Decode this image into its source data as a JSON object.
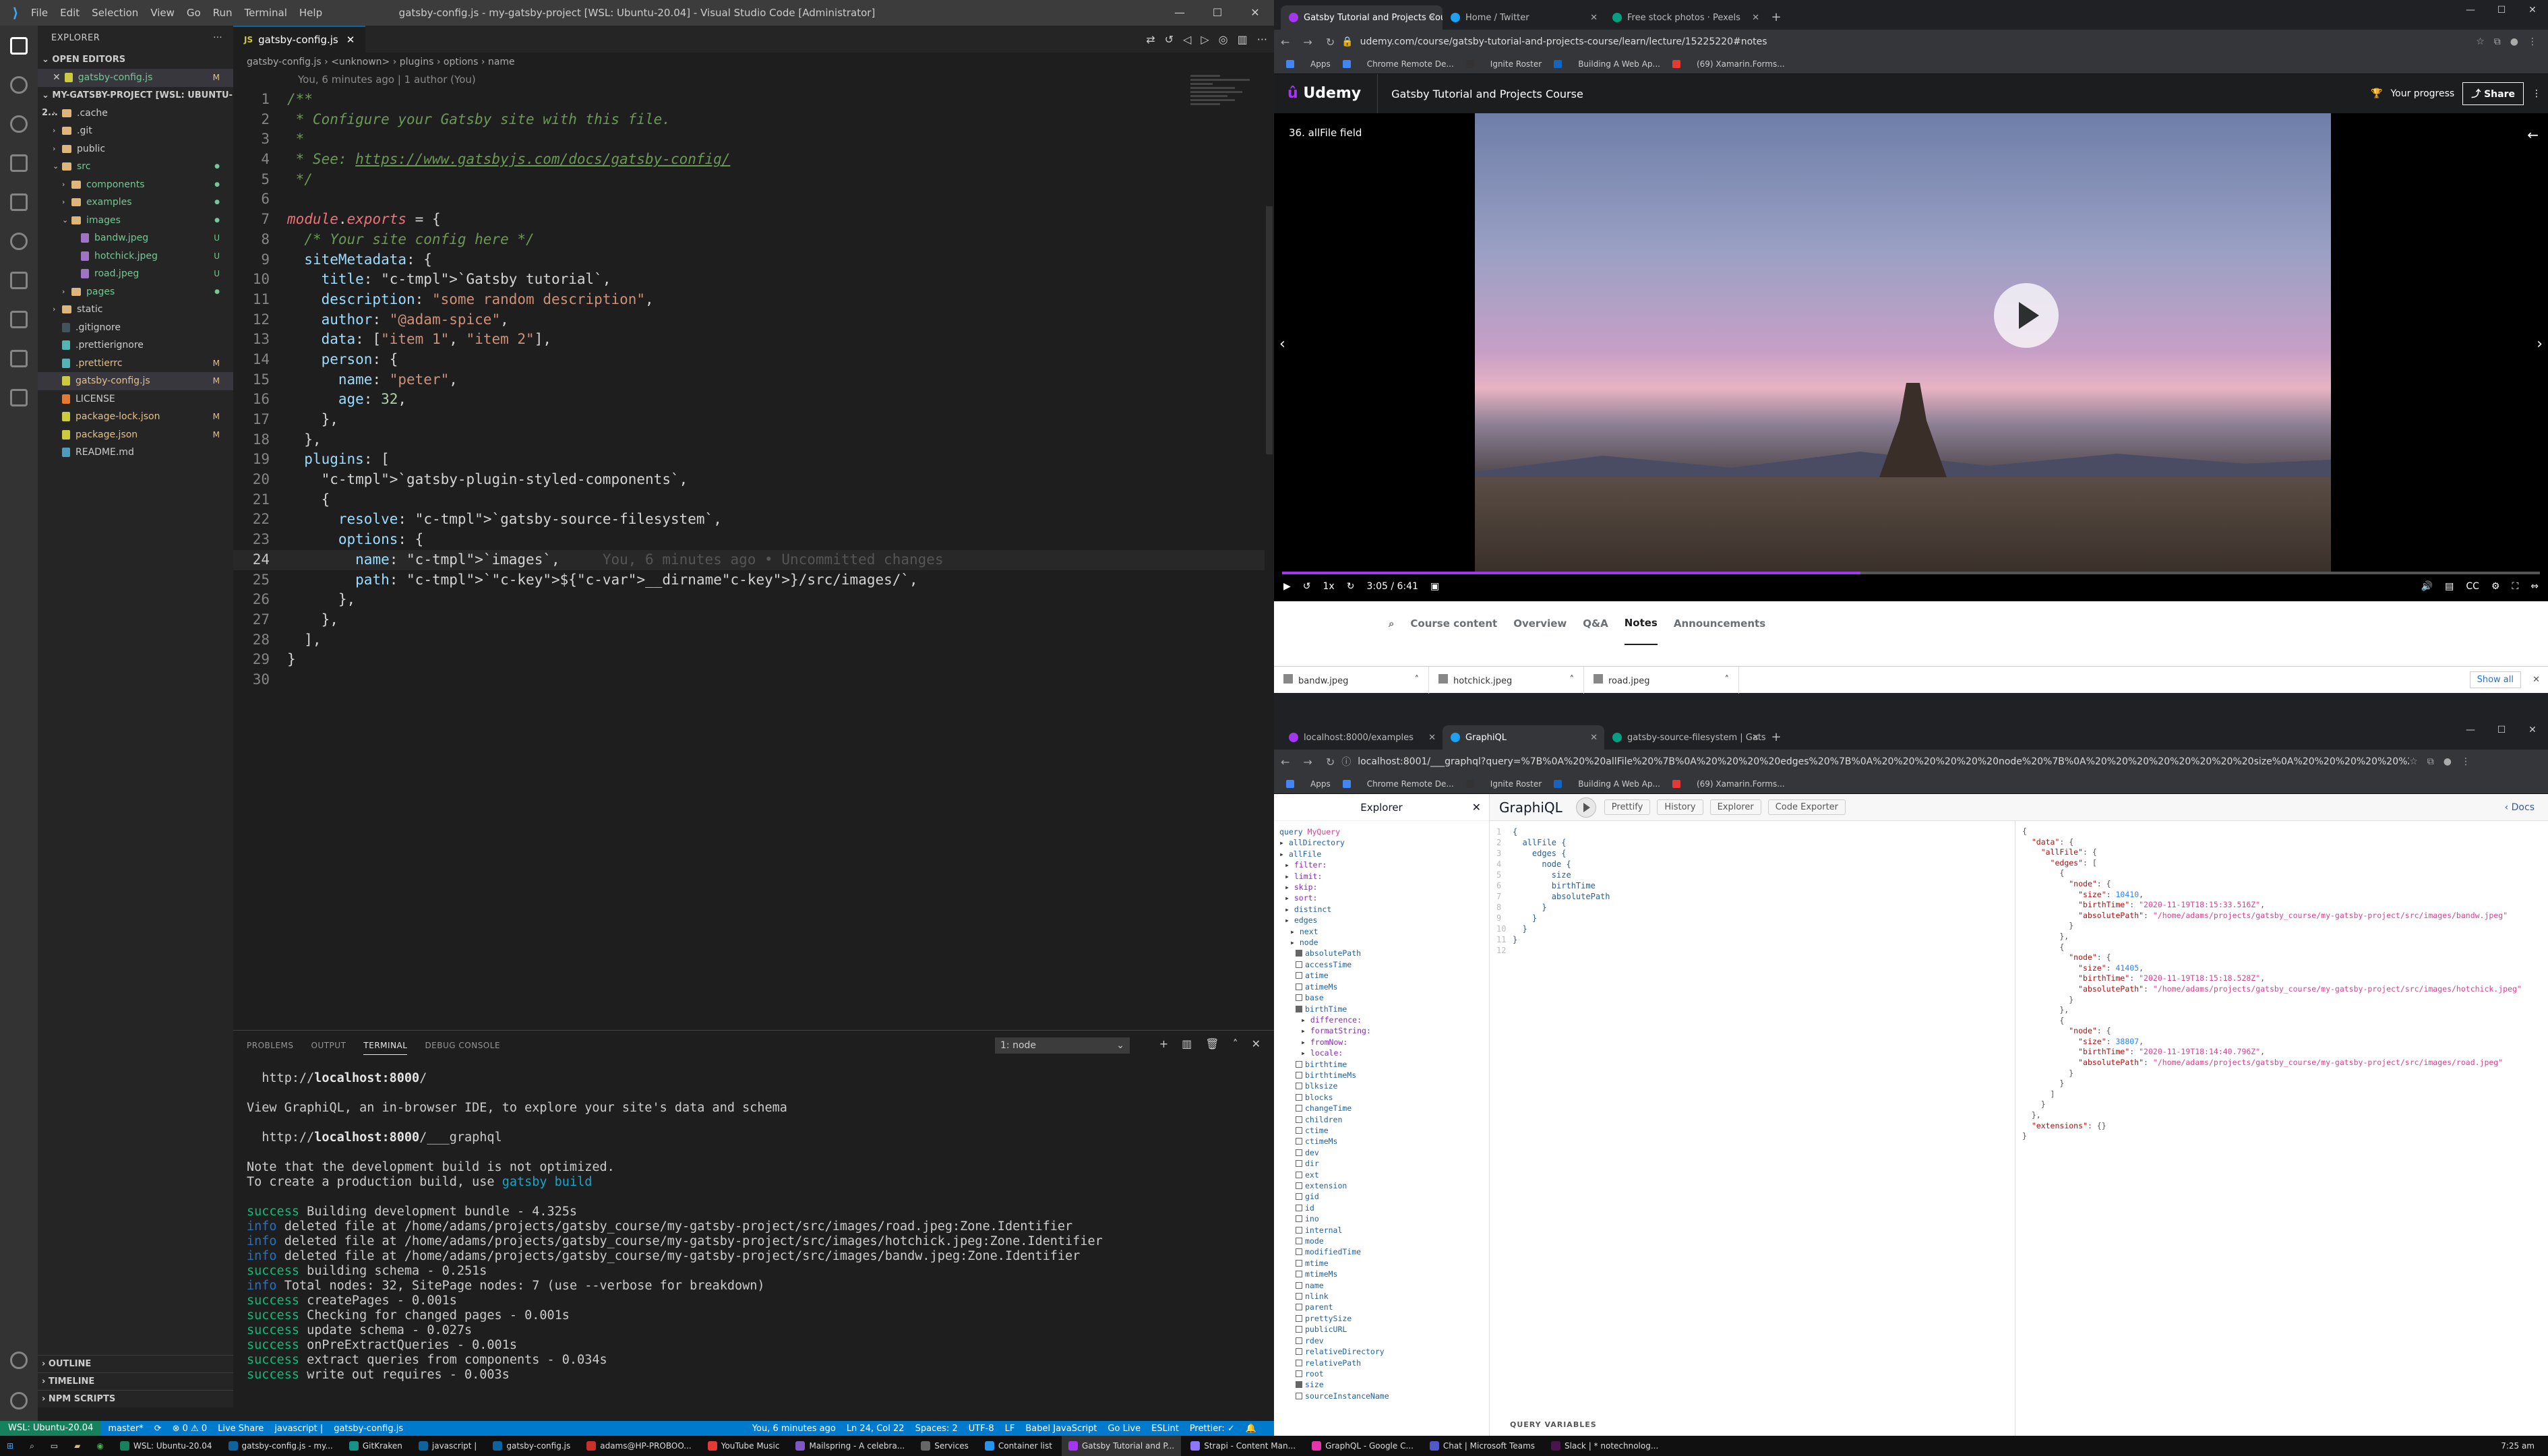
{
  "vscode": {
    "title": "gatsby-config.js - my-gatsby-project [WSL: Ubuntu-20.04] - Visual Studio Code [Administrator]",
    "menu": [
      "File",
      "Edit",
      "Selection",
      "View",
      "Go",
      "Run",
      "Terminal",
      "Help"
    ],
    "explorer_label": "EXPLORER",
    "open_editors_label": "OPEN EDITORS",
    "open_editor_file": "gatsby-config.js",
    "open_editor_badge": "M",
    "project_label": "MY-GATSBY-PROJECT [WSL: UBUNTU-2...",
    "tree": [
      {
        "name": ".cache",
        "git": ""
      },
      {
        "name": ".git",
        "git": ""
      },
      {
        "name": "public",
        "git": ""
      },
      {
        "name": "src",
        "git": ""
      },
      {
        "name": "components",
        "git": ""
      },
      {
        "name": "examples",
        "git": ""
      },
      {
        "name": "images",
        "git": ""
      },
      {
        "name": "bandw.jpeg",
        "git": "U"
      },
      {
        "name": "hotchick.jpeg",
        "git": "U"
      },
      {
        "name": "road.jpeg",
        "git": "U"
      },
      {
        "name": "pages",
        "git": ""
      },
      {
        "name": "static",
        "git": ""
      },
      {
        "name": ".gitignore",
        "git": ""
      },
      {
        "name": ".prettierignore",
        "git": ""
      },
      {
        "name": ".prettierrc",
        "git": "M"
      },
      {
        "name": "gatsby-config.js",
        "git": "M"
      },
      {
        "name": "LICENSE",
        "git": ""
      },
      {
        "name": "package-lock.json",
        "git": "M"
      },
      {
        "name": "package.json",
        "git": "M"
      },
      {
        "name": "README.md",
        "git": ""
      }
    ],
    "outline_label": "OUTLINE",
    "timeline_label": "TIMELINE",
    "npm_label": "NPM SCRIPTS",
    "tab_label": "gatsby-config.js",
    "breadcrumb": [
      "gatsby-config.js",
      "<unknown>",
      "plugins",
      "options",
      "name"
    ],
    "blame_top": "You, 6 minutes ago | 1 author (You)",
    "ghost_blame": "You, 6 minutes ago • Uncommitted changes",
    "code_lines": [
      "/**",
      " * Configure your Gatsby site with this file.",
      " *",
      " * See: https://www.gatsbyjs.com/docs/gatsby-config/",
      " */",
      "",
      "module.exports = {",
      "  /* Your site config here */",
      "  siteMetadata: {",
      "    title: `Gatsby tutorial`,",
      "    description: \"some random description\",",
      "    author: \"@adam-spice\",",
      "    data: [\"item 1\", \"item 2\"],",
      "    person: {",
      "      name: \"peter\",",
      "      age: 32,",
      "    },",
      "  },",
      "  plugins: [",
      "    `gatsby-plugin-styled-components`,",
      "    {",
      "      resolve: `gatsby-source-filesystem`,",
      "      options: {",
      "        name: `images`,",
      "        path: `${__dirname}/src/images/`,",
      "      },",
      "    },",
      "  ],",
      "}",
      ""
    ],
    "panel_tabs": [
      "PROBLEMS",
      "OUTPUT",
      "TERMINAL",
      "DEBUG CONSOLE"
    ],
    "terminal_select": "1: node",
    "terminal_lines": [
      {
        "t": "  http://localhost:8000/",
        "c": ""
      },
      {
        "t": "",
        "c": ""
      },
      {
        "t": "View GraphiQL, an in-browser IDE, to explore your site's data and schema",
        "c": ""
      },
      {
        "t": "",
        "c": ""
      },
      {
        "t": "  http://localhost:8000/___graphql",
        "c": ""
      },
      {
        "t": "",
        "c": ""
      },
      {
        "t": "Note that the development build is not optimized.",
        "c": ""
      },
      {
        "t": "To create a production build, use gatsby build",
        "c": ""
      },
      {
        "t": "",
        "c": ""
      },
      {
        "t": "success Building development bundle - 4.325s",
        "c": "s"
      },
      {
        "t": "info deleted file at /home/adams/projects/gatsby_course/my-gatsby-project/src/images/road.jpeg:Zone.Identifier",
        "c": "i"
      },
      {
        "t": "info deleted file at /home/adams/projects/gatsby_course/my-gatsby-project/src/images/hotchick.jpeg:Zone.Identifier",
        "c": "i"
      },
      {
        "t": "info deleted file at /home/adams/projects/gatsby_course/my-gatsby-project/src/images/bandw.jpeg:Zone.Identifier",
        "c": "i"
      },
      {
        "t": "success building schema - 0.251s",
        "c": "s"
      },
      {
        "t": "info Total nodes: 32, SitePage nodes: 7 (use --verbose for breakdown)",
        "c": "i"
      },
      {
        "t": "success createPages - 0.001s",
        "c": "s"
      },
      {
        "t": "success Checking for changed pages - 0.001s",
        "c": "s"
      },
      {
        "t": "success update schema - 0.027s",
        "c": "s"
      },
      {
        "t": "success onPreExtractQueries - 0.001s",
        "c": "s"
      },
      {
        "t": "success extract queries from components - 0.034s",
        "c": "s"
      },
      {
        "t": "success write out requires - 0.003s",
        "c": "s"
      }
    ],
    "status": {
      "remote": "WSL: Ubuntu-20.04",
      "branch": "master*",
      "errors": "⊗ 0 ⚠ 0",
      "live_share": "Live Share",
      "js": "javascript |",
      "file": "gatsby-config.js",
      "blame": "You, 6 minutes ago",
      "position": "Ln 24, Col 22",
      "spaces": "Spaces: 2",
      "encoding": "UTF-8",
      "eol": "LF",
      "lang": "Babel JavaScript",
      "golive": "Go Live",
      "eslint": "ESLint",
      "prettier": "Prettier: ✓"
    }
  },
  "browser_top": {
    "tabs": [
      "Gatsby Tutorial and Projects Cou",
      "Home / Twitter",
      "Free stock photos · Pexels"
    ],
    "url": "udemy.com/course/gatsby-tutorial-and-projects-course/learn/lecture/15225220#notes",
    "bookmarks": [
      "Apps",
      "Chrome Remote De...",
      "Ignite Roster",
      "Building A Web Ap...",
      "(69) Xamarin.Forms..."
    ],
    "udemy_logo": "Udemy",
    "course_title": "Gatsby Tutorial and Projects Course",
    "progress_label": "Your progress",
    "share_label": "Share",
    "lecture": "36. allFile field",
    "time": "3:05 / 6:41",
    "speed": "1x",
    "video_progress": 0.46,
    "course_tabs": [
      "Course content",
      "Overview",
      "Q&A",
      "Notes",
      "Announcements"
    ],
    "downloads": [
      "bandw.jpeg",
      "hotchick.jpeg",
      "road.jpeg"
    ],
    "show_all": "Show all"
  },
  "browser_bottom": {
    "tabs": [
      "localhost:8000/examples",
      "GraphiQL",
      "gatsby-source-filesystem | Gats"
    ],
    "url": "localhost:8001/___graphql?query=%7B%0A%20%20allFile%20%7B%0A%20%20%20%20edges%20%7B%0A%20%20%20%20%20%20node%20%7B%0A%20%20%20%20%20%20%20%20size%0A%20%20%20%20%20%20%20%20birthTime%0A%20%20%20%20%20%20%20",
    "bookmarks": [
      "Apps",
      "Chrome Remote De...",
      "Ignite Roster",
      "Building A Web Ap...",
      "(69) Xamarin.Forms..."
    ],
    "explorer_title": "Explorer",
    "query_name": "MyQuery",
    "graphiql_title": "GraphiQL",
    "buttons": [
      "Prettify",
      "History",
      "Explorer",
      "Code Exporter"
    ],
    "docs": "Docs",
    "explorer_fields": [
      {
        "t": "allDirectory",
        "lvl": 0,
        "k": "f",
        "chk": ""
      },
      {
        "t": "allFile",
        "lvl": 0,
        "k": "f",
        "chk": ""
      },
      {
        "t": "filter:",
        "lvl": 1,
        "k": "a",
        "chk": ""
      },
      {
        "t": "limit:",
        "lvl": 1,
        "k": "a",
        "chk": ""
      },
      {
        "t": "skip:",
        "lvl": 1,
        "k": "a",
        "chk": ""
      },
      {
        "t": "sort:",
        "lvl": 1,
        "k": "a",
        "chk": ""
      },
      {
        "t": "distinct",
        "lvl": 1,
        "k": "f",
        "chk": ""
      },
      {
        "t": "edges",
        "lvl": 1,
        "k": "f",
        "chk": ""
      },
      {
        "t": "next",
        "lvl": 2,
        "k": "f",
        "chk": ""
      },
      {
        "t": "node",
        "lvl": 2,
        "k": "f",
        "chk": ""
      },
      {
        "t": "absolutePath",
        "lvl": 3,
        "k": "f",
        "chk": "on"
      },
      {
        "t": "accessTime",
        "lvl": 3,
        "k": "f",
        "chk": "off"
      },
      {
        "t": "atime",
        "lvl": 3,
        "k": "f",
        "chk": "off"
      },
      {
        "t": "atimeMs",
        "lvl": 3,
        "k": "f",
        "chk": "off"
      },
      {
        "t": "base",
        "lvl": 3,
        "k": "f",
        "chk": "off"
      },
      {
        "t": "birthTime",
        "lvl": 3,
        "k": "f",
        "chk": "on"
      },
      {
        "t": "difference:",
        "lvl": 4,
        "k": "a",
        "chk": ""
      },
      {
        "t": "formatString:",
        "lvl": 4,
        "k": "a",
        "chk": ""
      },
      {
        "t": "fromNow:",
        "lvl": 4,
        "k": "a",
        "chk": ""
      },
      {
        "t": "locale:",
        "lvl": 4,
        "k": "a",
        "chk": ""
      },
      {
        "t": "birthtime",
        "lvl": 3,
        "k": "f",
        "chk": "off"
      },
      {
        "t": "birthtimeMs",
        "lvl": 3,
        "k": "f",
        "chk": "off"
      },
      {
        "t": "blksize",
        "lvl": 3,
        "k": "f",
        "chk": "off"
      },
      {
        "t": "blocks",
        "lvl": 3,
        "k": "f",
        "chk": "off"
      },
      {
        "t": "changeTime",
        "lvl": 3,
        "k": "f",
        "chk": "off"
      },
      {
        "t": "children",
        "lvl": 3,
        "k": "f",
        "chk": "off"
      },
      {
        "t": "ctime",
        "lvl": 3,
        "k": "f",
        "chk": "off"
      },
      {
        "t": "ctimeMs",
        "lvl": 3,
        "k": "f",
        "chk": "off"
      },
      {
        "t": "dev",
        "lvl": 3,
        "k": "f",
        "chk": "off"
      },
      {
        "t": "dir",
        "lvl": 3,
        "k": "f",
        "chk": "off"
      },
      {
        "t": "ext",
        "lvl": 3,
        "k": "f",
        "chk": "off"
      },
      {
        "t": "extension",
        "lvl": 3,
        "k": "f",
        "chk": "off"
      },
      {
        "t": "gid",
        "lvl": 3,
        "k": "f",
        "chk": "off"
      },
      {
        "t": "id",
        "lvl": 3,
        "k": "f",
        "chk": "off"
      },
      {
        "t": "ino",
        "lvl": 3,
        "k": "f",
        "chk": "off"
      },
      {
        "t": "internal",
        "lvl": 3,
        "k": "f",
        "chk": "off"
      },
      {
        "t": "mode",
        "lvl": 3,
        "k": "f",
        "chk": "off"
      },
      {
        "t": "modifiedTime",
        "lvl": 3,
        "k": "f",
        "chk": "off"
      },
      {
        "t": "mtime",
        "lvl": 3,
        "k": "f",
        "chk": "off"
      },
      {
        "t": "mtimeMs",
        "lvl": 3,
        "k": "f",
        "chk": "off"
      },
      {
        "t": "name",
        "lvl": 3,
        "k": "f",
        "chk": "off"
      },
      {
        "t": "nlink",
        "lvl": 3,
        "k": "f",
        "chk": "off"
      },
      {
        "t": "parent",
        "lvl": 3,
        "k": "f",
        "chk": "off"
      },
      {
        "t": "prettySize",
        "lvl": 3,
        "k": "f",
        "chk": "off"
      },
      {
        "t": "publicURL",
        "lvl": 3,
        "k": "f",
        "chk": "off"
      },
      {
        "t": "rdev",
        "lvl": 3,
        "k": "f",
        "chk": "off"
      },
      {
        "t": "relativeDirectory",
        "lvl": 3,
        "k": "f",
        "chk": "off"
      },
      {
        "t": "relativePath",
        "lvl": 3,
        "k": "f",
        "chk": "off"
      },
      {
        "t": "root",
        "lvl": 3,
        "k": "f",
        "chk": "off"
      },
      {
        "t": "size",
        "lvl": 3,
        "k": "f",
        "chk": "on"
      },
      {
        "t": "sourceInstanceName",
        "lvl": 3,
        "k": "f",
        "chk": "off"
      }
    ],
    "query_lines": [
      "{",
      "  allFile {",
      "    edges {",
      "      node {",
      "        size",
      "        birthTime",
      "        absolutePath",
      "      }",
      "    }",
      "  }",
      "}",
      ""
    ],
    "query_vars": "QUERY VARIABLES",
    "result": {
      "nodes": [
        {
          "size": "10410",
          "birthTime": "2020-11-19T18:15:33.516Z",
          "absolutePath": "/home/adams/projects/gatsby_course/my-gatsby-project/src/images/bandw.jpeg"
        },
        {
          "size": "41405",
          "birthTime": "2020-11-19T18:15:18.528Z",
          "absolutePath": "/home/adams/projects/gatsby_course/my-gatsby-project/src/images/hotchick.jpeg"
        },
        {
          "size": "38807",
          "birthTime": "2020-11-19T18:14:40.796Z",
          "absolutePath": "/home/adams/projects/gatsby_course/my-gatsby-project/src/images/road.jpeg"
        }
      ]
    }
  },
  "taskbar": {
    "items": [
      "WSL: Ubuntu-20.04",
      "gatsby-config.js - my...",
      "GitKraken",
      "javascript |",
      "gatsby-config.js",
      "adams@HP-PROBOO...",
      "YouTube Music",
      "Mailspring - A celebra...",
      "Services",
      "Container list",
      "Gatsby Tutorial and P...",
      "Strapi - Content Man...",
      "GraphQL - Google C...",
      "Chat | Microsoft Teams",
      "Slack | * notechnolog..."
    ],
    "clock": "7:25 am"
  }
}
